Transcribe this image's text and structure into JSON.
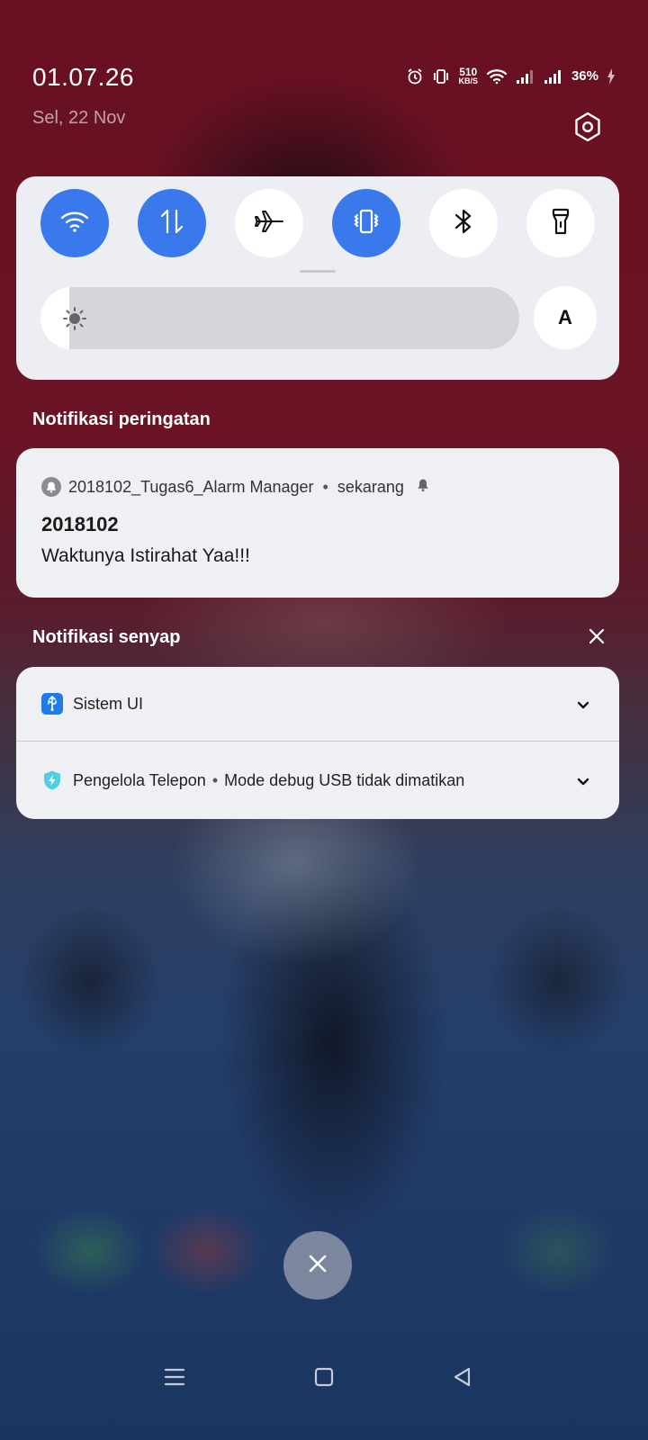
{
  "status_bar": {
    "time": "01.07.26",
    "date": "Sel, 22 Nov",
    "net_speed_value": "510",
    "net_speed_unit": "KB/S",
    "battery": "36%",
    "icons": [
      "alarm-icon",
      "vibrate-icon",
      "wifi-icon",
      "signal-icon",
      "signal-icon",
      "charging-icon",
      "settings-icon"
    ]
  },
  "quick_settings": {
    "tiles": [
      {
        "name": "wifi",
        "icon": "wifi-icon",
        "active": true
      },
      {
        "name": "mobile-data",
        "icon": "data-transfer-icon",
        "active": true
      },
      {
        "name": "airplane-mode",
        "icon": "airplane-icon",
        "active": false
      },
      {
        "name": "vibrate",
        "icon": "vibrate-icon",
        "active": true
      },
      {
        "name": "bluetooth",
        "icon": "bluetooth-icon",
        "active": false
      },
      {
        "name": "flashlight",
        "icon": "flashlight-icon",
        "active": false
      }
    ],
    "brightness_level": 0.06,
    "auto_brightness_label": "A",
    "colors": {
      "active": "#3a79ec",
      "inactive": "#ffffff",
      "panel": "#eceef3"
    }
  },
  "alert_section": {
    "title": "Notifikasi peringatan",
    "notification": {
      "app_name": "2018102_Tugas6_Alarm Manager",
      "separator": "•",
      "time": "sekarang",
      "title": "2018102",
      "text": "Waktunya Istirahat Yaa!!!"
    }
  },
  "silent_section": {
    "title": "Notifikasi senyap",
    "items": [
      {
        "app_name": "Sistem UI",
        "icon": "usb-icon",
        "icon_color": "#1f7be8"
      },
      {
        "app_name": "Pengelola Telepon",
        "separator": "•",
        "text": "Mode debug USB tidak dimatikan",
        "icon": "shield-bolt-icon",
        "icon_color": "#4fd0e0"
      }
    ]
  },
  "navigation": {
    "buttons": [
      "menu-icon",
      "home-icon",
      "back-icon"
    ]
  }
}
